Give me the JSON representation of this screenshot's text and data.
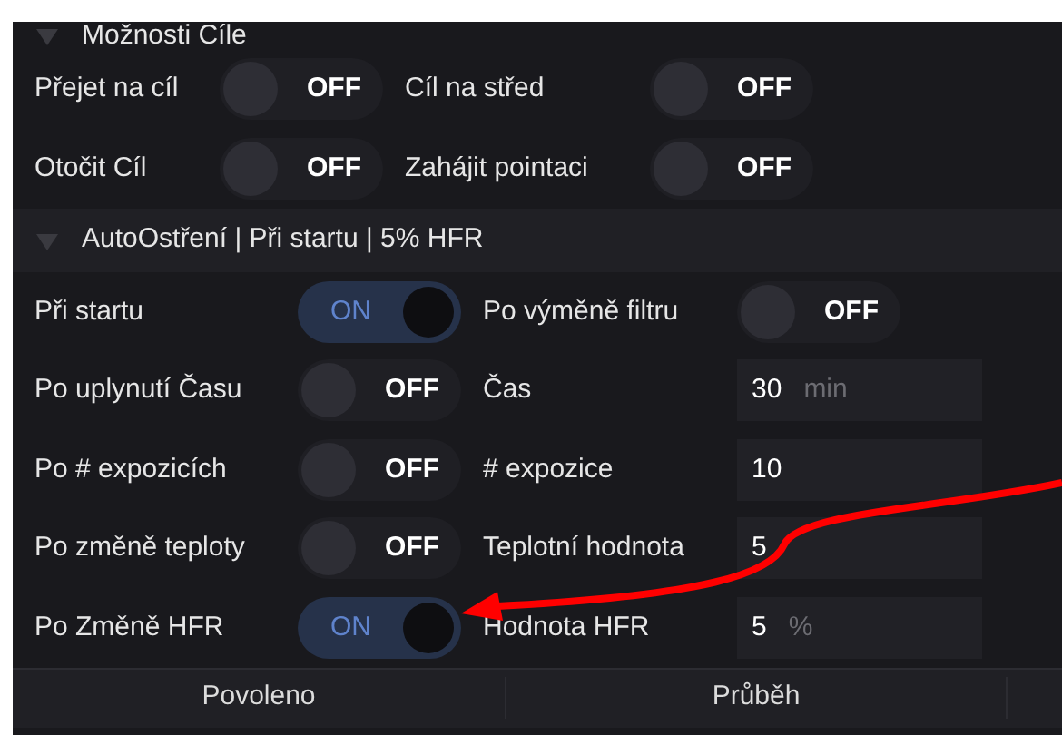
{
  "sections": [
    {
      "title": "Možnosti Cíle",
      "expanded": true,
      "rows": [
        {
          "items": [
            {
              "kind": "toggle",
              "label": "Přejet na cíl",
              "on": false,
              "state_text": "OFF"
            },
            {
              "kind": "toggle",
              "label": "Cíl na střed",
              "on": false,
              "state_text": "OFF"
            }
          ]
        },
        {
          "items": [
            {
              "kind": "toggle",
              "label": "Otočit Cíl",
              "on": false,
              "state_text": "OFF"
            },
            {
              "kind": "toggle",
              "label": "Zahájit pointaci",
              "on": false,
              "state_text": "OFF"
            }
          ]
        }
      ]
    },
    {
      "title": "AutoOstření | Při startu | 5% HFR",
      "expanded": true,
      "rows": [
        {
          "items": [
            {
              "kind": "toggle",
              "label": "Při startu",
              "on": true,
              "state_text": "ON"
            },
            {
              "kind": "toggle",
              "label": "Po výměně filtru",
              "on": false,
              "state_text": "OFF"
            }
          ]
        },
        {
          "items": [
            {
              "kind": "toggle",
              "label": "Po uplynutí Času",
              "on": false,
              "state_text": "OFF"
            },
            {
              "kind": "input",
              "label": "Čas",
              "value": "30",
              "unit": "min"
            }
          ]
        },
        {
          "items": [
            {
              "kind": "toggle",
              "label": "Po # expozicích",
              "on": false,
              "state_text": "OFF"
            },
            {
              "kind": "input",
              "label": "# expozice",
              "value": "10"
            }
          ]
        },
        {
          "items": [
            {
              "kind": "toggle",
              "label": "Po změně teploty",
              "on": false,
              "state_text": "OFF"
            },
            {
              "kind": "input",
              "label": "Teplotní hodnota",
              "value": "5"
            }
          ]
        },
        {
          "items": [
            {
              "kind": "toggle",
              "label": "Po Změně HFR",
              "on": true,
              "state_text": "ON"
            },
            {
              "kind": "input",
              "label": "Hodnota HFR",
              "value": "5",
              "unit": "%"
            }
          ]
        }
      ]
    }
  ],
  "table": {
    "columns": [
      "Povoleno",
      "Průběh"
    ]
  }
}
